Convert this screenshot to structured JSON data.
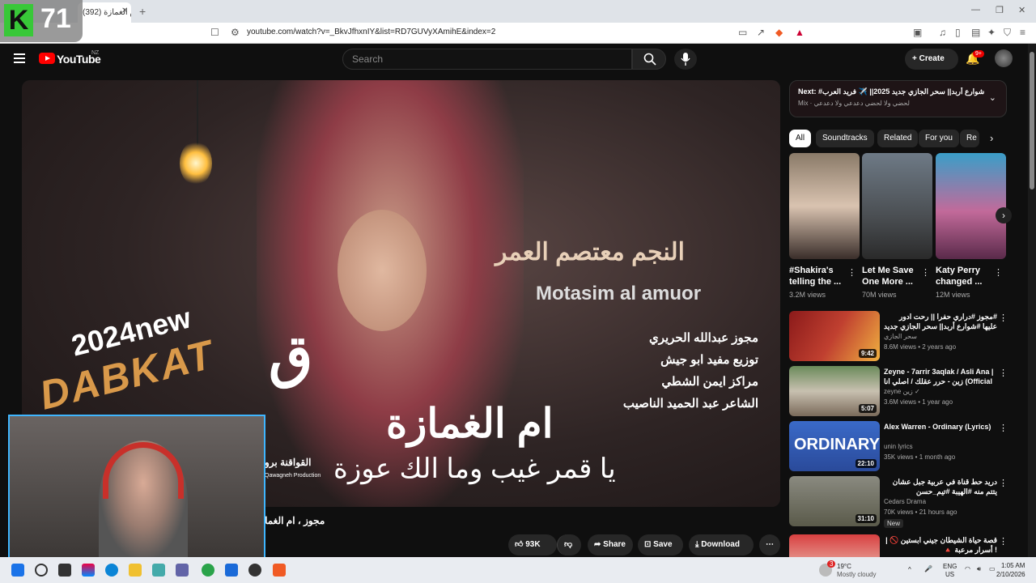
{
  "browser": {
    "tab_title": "(392) مجوز ، ام الغمازة",
    "url": "youtube.com/watch?v=_BkvJfhxnIY&list=RD7GUVyXAmihE&index=2",
    "overlay_logo_letter": "K",
    "overlay_logo_number": "71"
  },
  "header": {
    "brand": "YouTube",
    "country": "NZ",
    "search_placeholder": "Search",
    "create_label": "Create",
    "notif_count": "9+"
  },
  "video": {
    "year_text": "2024new",
    "dabkat_text": "DABKAT",
    "star_arabic": "النجم معتصم العمر",
    "star_latin": "Motasim al amuor",
    "credits": [
      "مجوز عبدالله الحريري",
      "توزيع مفيد ابو جيش",
      "مراكز ايمن الشطي",
      "الشاعر عبد الحميد الناصيب"
    ],
    "song_title": "ام الغمازة",
    "song_subtitle": "يا قمر غيب وما الك عوزة",
    "brand_text": "القواقنة برو",
    "brand_sub": "Qawagneh Production",
    "title": "مجوز ، ام الغمازة"
  },
  "actions": {
    "likes": "93K",
    "share": "Share",
    "save": "Save",
    "download": "Download"
  },
  "next": {
    "label": "Next: #شوارع أربد|| سحر الجازي جديد 2025|| ✈️ فريد العرب",
    "sub": "Mix · لحضي ولا لحضي دعدعي ولا دعدعي"
  },
  "chips": [
    "All",
    "Soundtracks",
    "Related",
    "For you",
    "Re"
  ],
  "shorts": [
    {
      "title": "#Shakira's telling the ...",
      "views": "3.2M views"
    },
    {
      "title": "Let Me Save One More ...",
      "views": "70M views"
    },
    {
      "title": "Katy Perry changed ...",
      "views": "12M views"
    }
  ],
  "recommended": [
    {
      "title": "#مجوز #دراري حفرا || رحت ادور عليها #شوارع أربد|| سحر الجازي جديد 2025||",
      "channel": "سحر الجازي",
      "meta": "8.6M views • 2 years ago",
      "duration": "9:42",
      "new": ""
    },
    {
      "title": "Zeyne - 7arrir 3aqlak / Asli Ana | زين - حرر عقلك / اصلي انا (Official ...",
      "channel": "zeyne زين ✓",
      "meta": "3.6M views • 1 year ago",
      "duration": "5:07",
      "new": ""
    },
    {
      "title": "Alex Warren - Ordinary (Lyrics)",
      "channel": "unin lyrics",
      "meta": "35K views • 1 month ago",
      "duration": "22:10",
      "new": ""
    },
    {
      "title": "دريد حط قناة في عربية جبل عشان يتتم منه #الهيبة #تيم_حسن",
      "channel": "Cedars Drama",
      "meta": "70K views • 21 hours ago",
      "duration": "31:10",
      "new": "New"
    },
    {
      "title": "قصة حياة الشيطان جيني ابستين 🚫 | ! أسرار مرعبة 🔺",
      "channel": "",
      "meta": "",
      "duration": "",
      "new": ""
    }
  ],
  "taskbar": {
    "temp": "19°C",
    "weather": "Mostly cloudy",
    "lang": "ENG",
    "region": "US",
    "time": "1:05 AM",
    "date": "2/10/2026",
    "weather_badge": "3"
  }
}
